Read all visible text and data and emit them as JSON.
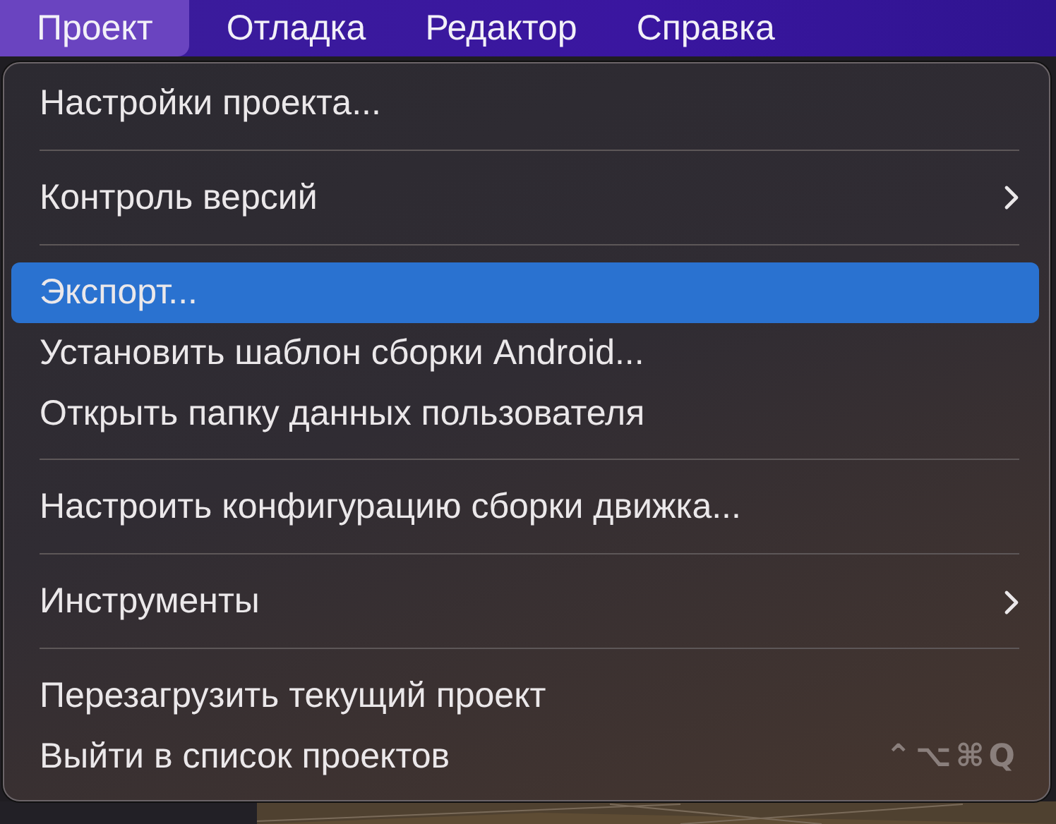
{
  "menubar": [
    {
      "label": "Проект",
      "selected": true
    },
    {
      "label": "Отладка",
      "selected": false
    },
    {
      "label": "Редактор",
      "selected": false
    },
    {
      "label": "Справка",
      "selected": false
    }
  ],
  "menu": {
    "items": [
      {
        "kind": "item",
        "label": "Настройки проекта...",
        "selected": false,
        "submenu": false
      },
      {
        "kind": "separator"
      },
      {
        "kind": "item",
        "label": "Контроль версий",
        "selected": false,
        "submenu": true
      },
      {
        "kind": "separator"
      },
      {
        "kind": "item",
        "label": "Экспорт...",
        "selected": true,
        "submenu": false
      },
      {
        "kind": "item",
        "label": "Установить шаблон сборки Android...",
        "selected": false,
        "submenu": false
      },
      {
        "kind": "item",
        "label": "Открыть папку данных пользователя",
        "selected": false,
        "submenu": false
      },
      {
        "kind": "separator"
      },
      {
        "kind": "item",
        "label": "Настроить конфигурацию сборки движка...",
        "selected": false,
        "submenu": false
      },
      {
        "kind": "separator"
      },
      {
        "kind": "item",
        "label": "Инструменты",
        "selected": false,
        "submenu": true
      },
      {
        "kind": "separator"
      },
      {
        "kind": "item",
        "label": "Перезагрузить текущий проект",
        "selected": false,
        "submenu": false
      },
      {
        "kind": "item",
        "label": "Выйти в список проектов",
        "selected": false,
        "submenu": false,
        "shortcut": "⌃⌥⌘Q"
      }
    ]
  }
}
